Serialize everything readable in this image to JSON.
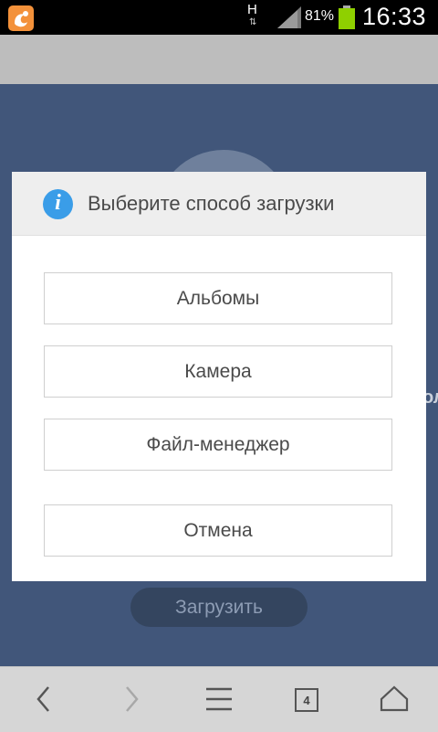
{
  "status_bar": {
    "network_type": "H",
    "network_arrows": "⇅",
    "battery_percent": "81%",
    "time": "16:33",
    "battery_level": 0.81
  },
  "page": {
    "partial_text": "ол",
    "upload_button_label": "Загрузить"
  },
  "dialog": {
    "title": "Выберите способ загрузки",
    "info_icon_glyph": "i",
    "options": [
      {
        "label": "Альбомы"
      },
      {
        "label": "Камера"
      },
      {
        "label": "Файл-менеджер"
      }
    ],
    "cancel_label": "Отмена"
  },
  "nav": {
    "tab_count": "4",
    "icons": [
      "back-icon",
      "forward-icon",
      "menu-icon",
      "tabs-icon",
      "home-icon"
    ]
  },
  "colors": {
    "page_bg": "#41567a",
    "accent_info": "#3a9de8",
    "battery": "#8fd000"
  }
}
